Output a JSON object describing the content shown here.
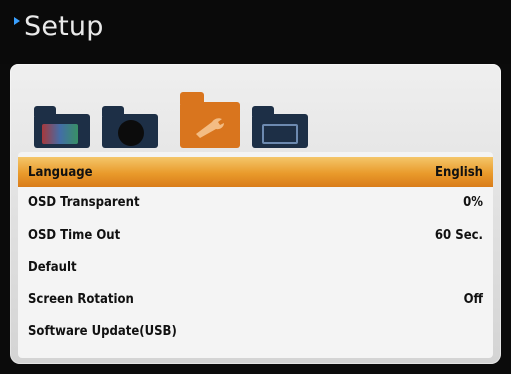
{
  "window": {
    "title": "Setup"
  },
  "category_icons": [
    {
      "name": "picture-folder-icon"
    },
    {
      "name": "sound-folder-icon"
    },
    {
      "name": "setup-folder-icon",
      "selected": true
    },
    {
      "name": "channel-folder-icon"
    }
  ],
  "menu": {
    "items": [
      {
        "label": "Language",
        "value": "English",
        "selected": true
      },
      {
        "label": "OSD Transparent",
        "value": "0%"
      },
      {
        "label": "OSD Time Out",
        "value": "60 Sec."
      },
      {
        "label": "Default",
        "value": ""
      },
      {
        "label": "Screen Rotation",
        "value": "Off"
      },
      {
        "label": "Software Update(USB)",
        "value": ""
      }
    ]
  },
  "colors": {
    "accent_bullet": "#3aa0ff",
    "selected_row": "#e99a2b",
    "selected_folder": "#d9751e",
    "folder": "#1d2f46"
  }
}
